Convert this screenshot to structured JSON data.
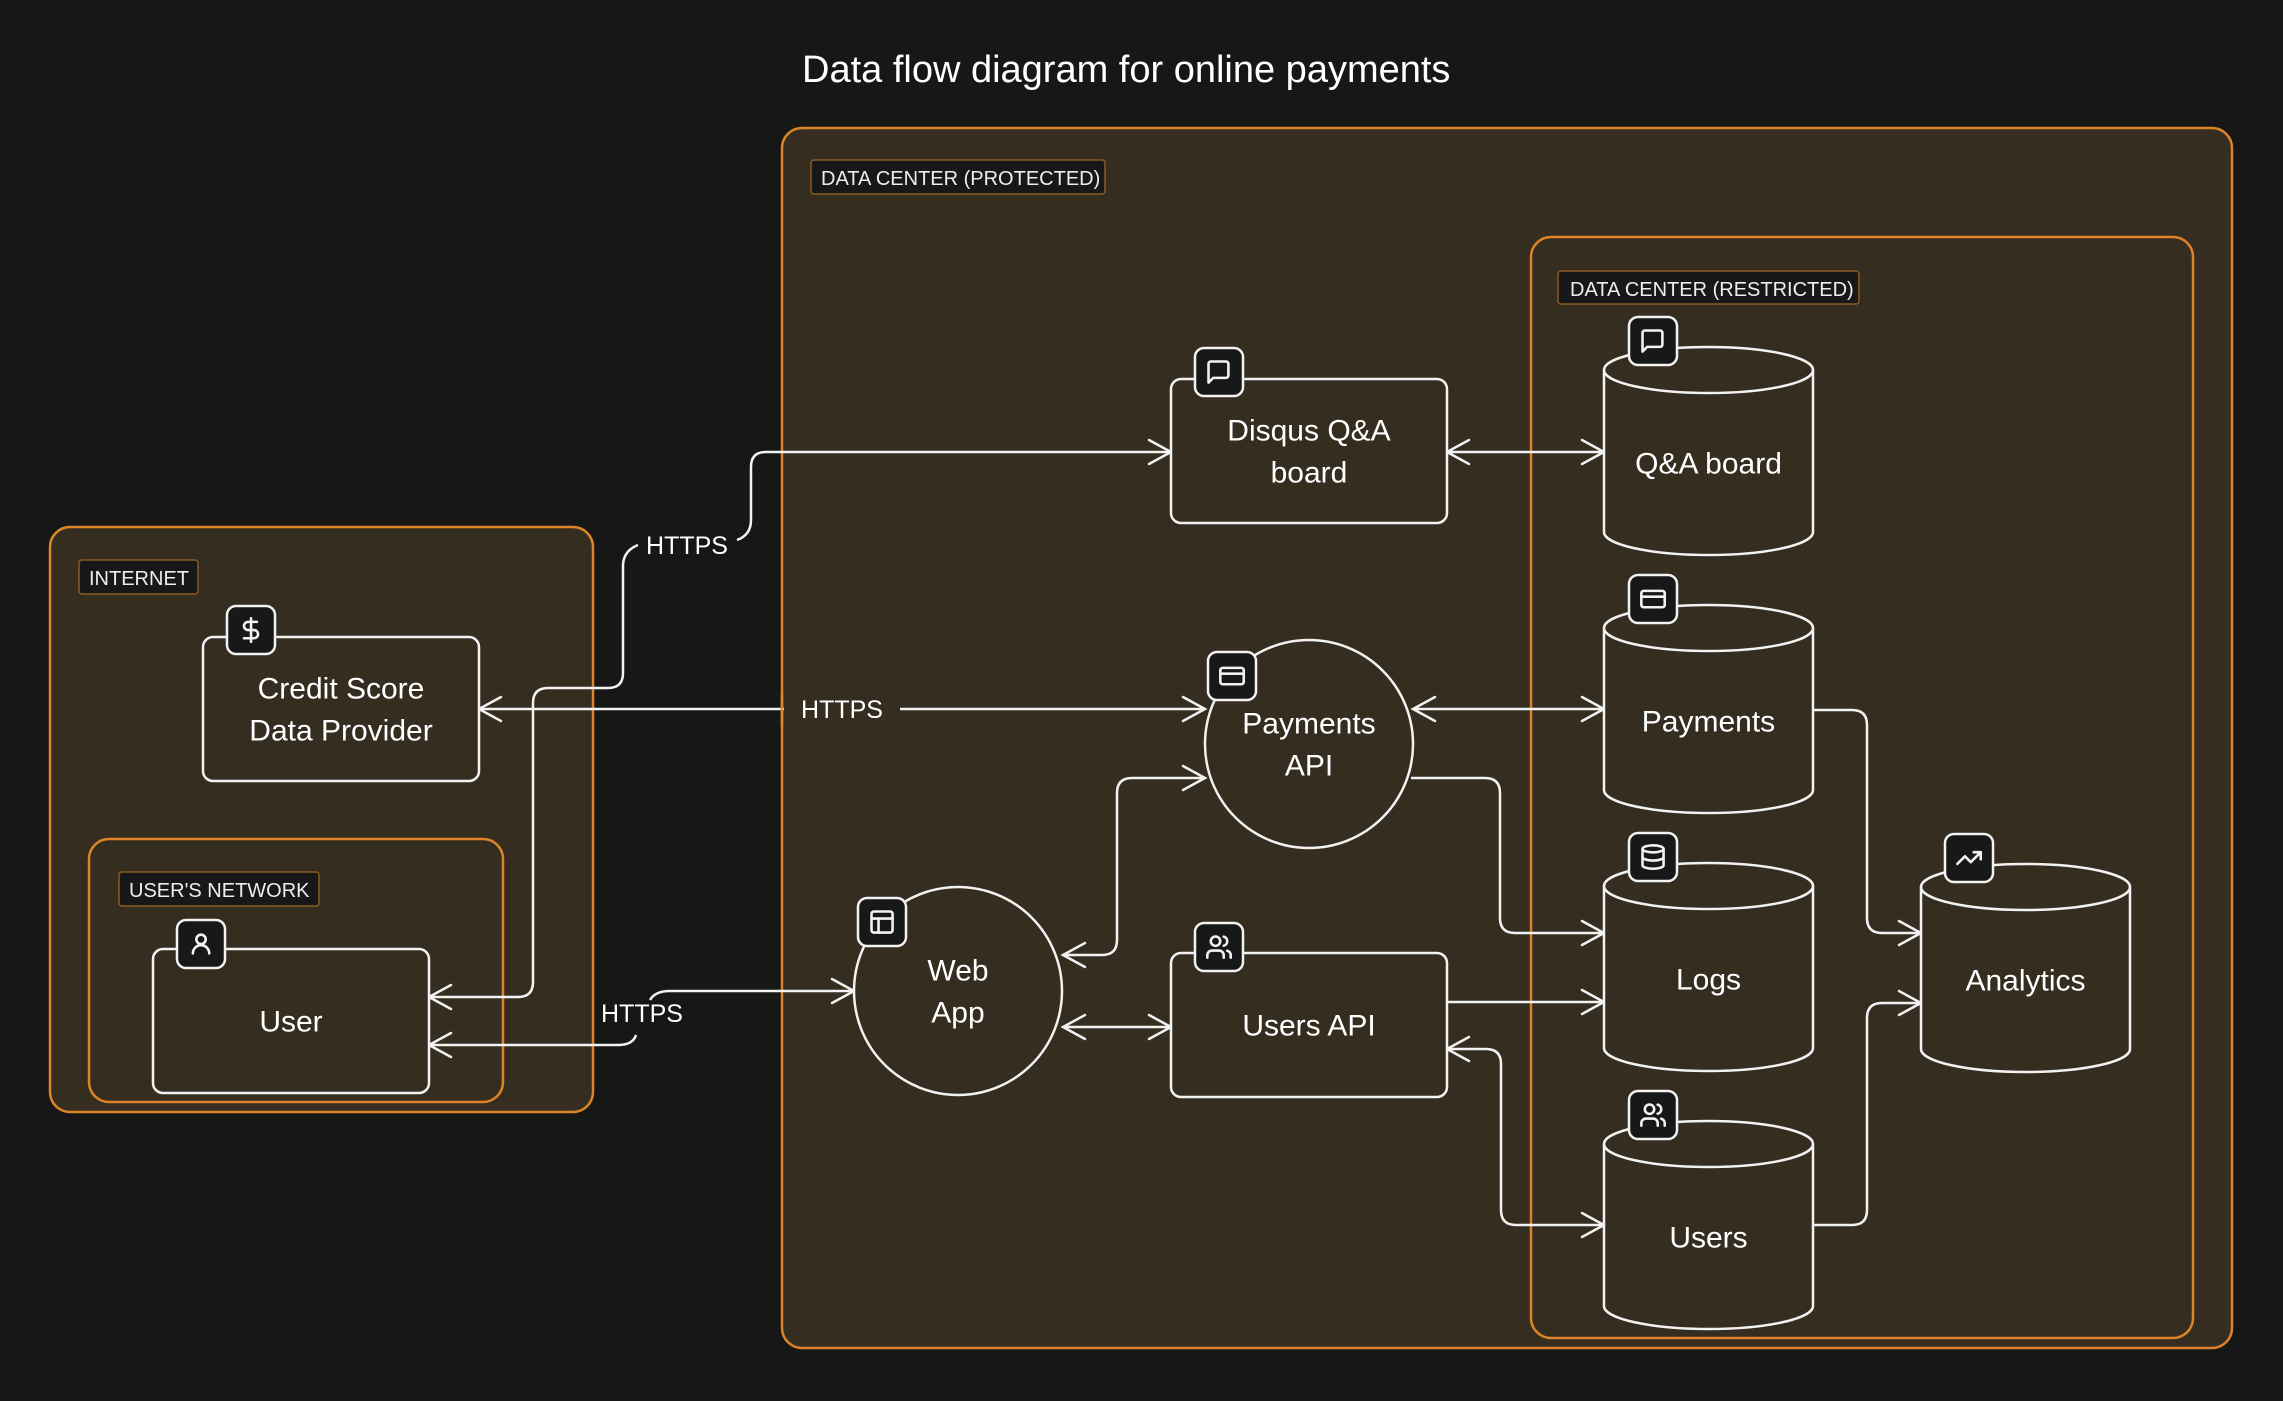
{
  "title": "Data flow diagram for online payments",
  "colors": {
    "background": "#171717",
    "group_fill": "#352d20",
    "group_border": "#dd8428",
    "label_bg": "#181818",
    "label_border": "#8b5a20",
    "stroke": "#f2f2f2",
    "text": "#ffffff"
  },
  "groups": {
    "internet": {
      "label": "INTERNET"
    },
    "users_network": {
      "label": "USER'S NETWORK"
    },
    "protected": {
      "label": "DATA CENTER (PROTECTED)"
    },
    "restricted": {
      "label": "DATA CENTER (RESTRICTED)"
    }
  },
  "nodes": {
    "credit_score": {
      "lines": [
        "Credit Score",
        "Data Provider"
      ],
      "shape": "rectangle",
      "icon": "dollar-icon"
    },
    "user": {
      "lines": [
        "User"
      ],
      "shape": "rectangle",
      "icon": "user-icon"
    },
    "disqus": {
      "lines": [
        "Disqus Q&A",
        "board"
      ],
      "shape": "rectangle",
      "icon": "message-square-icon"
    },
    "payments_api": {
      "lines": [
        "Payments",
        "API"
      ],
      "shape": "circle",
      "icon": "credit-card-icon"
    },
    "web_app": {
      "lines": [
        "Web",
        "App"
      ],
      "shape": "circle",
      "icon": "layout-icon"
    },
    "users_api": {
      "lines": [
        "Users API"
      ],
      "shape": "rectangle",
      "icon": "users-icon"
    },
    "qa_board": {
      "lines": [
        "Q&A board"
      ],
      "shape": "cylinder",
      "icon": "message-square-icon"
    },
    "payments_db": {
      "lines": [
        "Payments"
      ],
      "shape": "cylinder",
      "icon": "credit-card-icon"
    },
    "logs": {
      "lines": [
        "Logs"
      ],
      "shape": "cylinder",
      "icon": "database-icon"
    },
    "users_db": {
      "lines": [
        "Users"
      ],
      "shape": "cylinder",
      "icon": "users-icon"
    },
    "analytics": {
      "lines": [
        "Analytics"
      ],
      "shape": "cylinder",
      "icon": "trending-up-icon"
    }
  },
  "edges": [
    {
      "id": "user-disqus",
      "from": "user",
      "to": "disqus",
      "label": "HTTPS",
      "direction": "both"
    },
    {
      "id": "credit-payments-api",
      "from": "credit_score",
      "to": "payments_api",
      "label": "HTTPS",
      "direction": "both"
    },
    {
      "id": "user-webapp",
      "from": "user",
      "to": "web_app",
      "label": "HTTPS",
      "direction": "both"
    },
    {
      "id": "webapp-payments-api",
      "from": "web_app",
      "to": "payments_api",
      "label": "",
      "direction": "both"
    },
    {
      "id": "webapp-users-api",
      "from": "web_app",
      "to": "users_api",
      "label": "",
      "direction": "both"
    },
    {
      "id": "disqus-qa",
      "from": "disqus",
      "to": "qa_board",
      "label": "",
      "direction": "both"
    },
    {
      "id": "payments-api-db",
      "from": "payments_api",
      "to": "payments_db",
      "label": "",
      "direction": "both"
    },
    {
      "id": "payments-api-logs",
      "from": "payments_api",
      "to": "logs",
      "label": "",
      "direction": "forward"
    },
    {
      "id": "users-api-logs",
      "from": "users_api",
      "to": "logs",
      "label": "",
      "direction": "forward"
    },
    {
      "id": "users-api-db",
      "from": "users_api",
      "to": "users_db",
      "label": "",
      "direction": "both"
    },
    {
      "id": "payments-db-analytics",
      "from": "payments_db",
      "to": "analytics",
      "label": "",
      "direction": "forward"
    },
    {
      "id": "users-db-analytics",
      "from": "users_db",
      "to": "analytics",
      "label": "",
      "direction": "forward"
    }
  ]
}
